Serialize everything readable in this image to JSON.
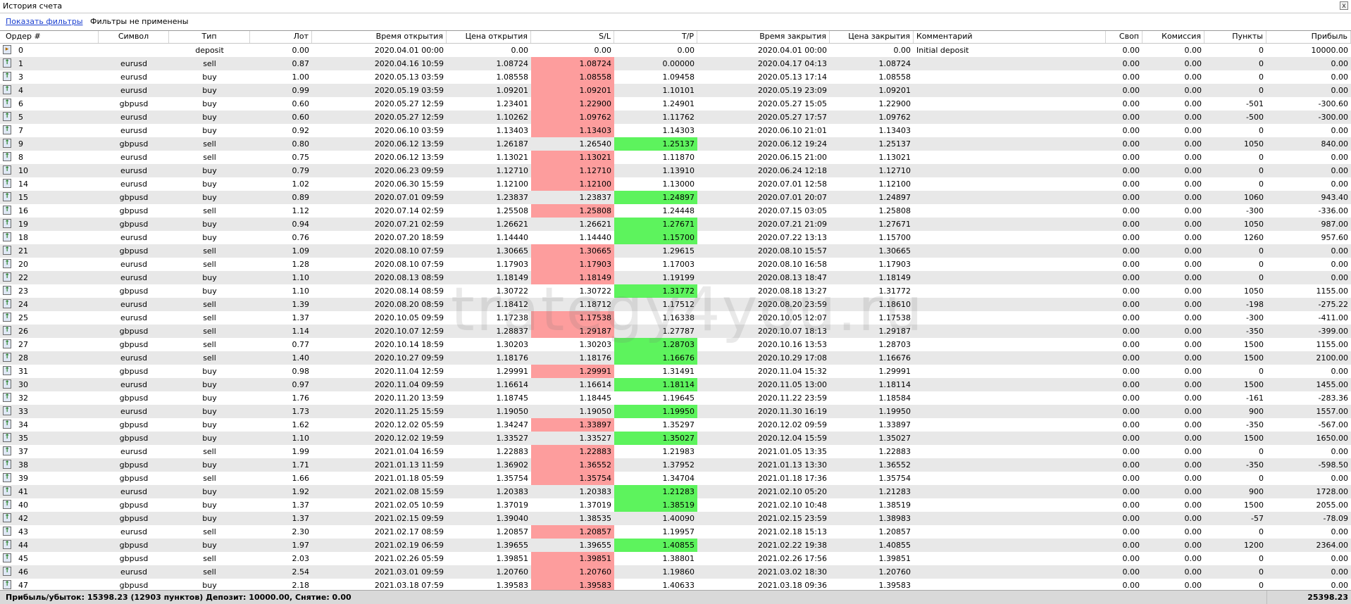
{
  "window": {
    "title": "История счета",
    "close_label": "x"
  },
  "filters": {
    "show_filters": "Показать фильтры",
    "status": "Фильтры не применены"
  },
  "columns": [
    "Ордер #",
    "Символ",
    "Тип",
    "Лот",
    "Время открытия",
    "Цена открытия",
    "S/L",
    "T/P",
    "Время закрытия",
    "Цена закрытия",
    "Комментарий",
    "Своп",
    "Комиссия",
    "Пункты",
    "Прибыль"
  ],
  "colors": {
    "sl_hit": "#fd9d9d",
    "tp_hit": "#5df35d",
    "alt_row": "#e8e8e8"
  },
  "watermark": "trategy4you.ru",
  "rows": [
    {
      "order": "0",
      "symbol": "",
      "type": "deposit",
      "lot": "0.00",
      "open_time": "2020.04.01 00:00",
      "open_price": "0.00",
      "sl": "0.00",
      "tp": "0.00",
      "close_time": "2020.04.01 00:00",
      "close_price": "0.00",
      "comment": "Initial deposit",
      "swap": "0.00",
      "commission": "0.00",
      "points": "0",
      "profit": "10000.00",
      "hl": "",
      "icon": "deposit-icon"
    },
    {
      "order": "1",
      "symbol": "eurusd",
      "type": "sell",
      "lot": "0.87",
      "open_time": "2020.04.16 10:59",
      "open_price": "1.08724",
      "sl": "1.08724",
      "tp": "0.00000",
      "close_time": "2020.04.17 04:13",
      "close_price": "1.08724",
      "comment": "",
      "swap": "0.00",
      "commission": "0.00",
      "points": "0",
      "profit": "0.00",
      "hl": "sl",
      "icon": "order-icon"
    },
    {
      "order": "3",
      "symbol": "eurusd",
      "type": "buy",
      "lot": "1.00",
      "open_time": "2020.05.13 03:59",
      "open_price": "1.08558",
      "sl": "1.08558",
      "tp": "1.09458",
      "close_time": "2020.05.13 17:14",
      "close_price": "1.08558",
      "comment": "",
      "swap": "0.00",
      "commission": "0.00",
      "points": "0",
      "profit": "0.00",
      "hl": "sl",
      "icon": "order-icon"
    },
    {
      "order": "4",
      "symbol": "eurusd",
      "type": "buy",
      "lot": "0.99",
      "open_time": "2020.05.19 03:59",
      "open_price": "1.09201",
      "sl": "1.09201",
      "tp": "1.10101",
      "close_time": "2020.05.19 23:09",
      "close_price": "1.09201",
      "comment": "",
      "swap": "0.00",
      "commission": "0.00",
      "points": "0",
      "profit": "0.00",
      "hl": "sl",
      "icon": "order-icon"
    },
    {
      "order": "6",
      "symbol": "gbpusd",
      "type": "buy",
      "lot": "0.60",
      "open_time": "2020.05.27 12:59",
      "open_price": "1.23401",
      "sl": "1.22900",
      "tp": "1.24901",
      "close_time": "2020.05.27 15:05",
      "close_price": "1.22900",
      "comment": "",
      "swap": "0.00",
      "commission": "0.00",
      "points": "-501",
      "profit": "-300.60",
      "hl": "sl",
      "icon": "order-icon"
    },
    {
      "order": "5",
      "symbol": "eurusd",
      "type": "buy",
      "lot": "0.60",
      "open_time": "2020.05.27 12:59",
      "open_price": "1.10262",
      "sl": "1.09762",
      "tp": "1.11762",
      "close_time": "2020.05.27 17:57",
      "close_price": "1.09762",
      "comment": "",
      "swap": "0.00",
      "commission": "0.00",
      "points": "-500",
      "profit": "-300.00",
      "hl": "sl",
      "icon": "order-icon"
    },
    {
      "order": "7",
      "symbol": "eurusd",
      "type": "buy",
      "lot": "0.92",
      "open_time": "2020.06.10 03:59",
      "open_price": "1.13403",
      "sl": "1.13403",
      "tp": "1.14303",
      "close_time": "2020.06.10 21:01",
      "close_price": "1.13403",
      "comment": "",
      "swap": "0.00",
      "commission": "0.00",
      "points": "0",
      "profit": "0.00",
      "hl": "sl",
      "icon": "order-icon"
    },
    {
      "order": "9",
      "symbol": "gbpusd",
      "type": "sell",
      "lot": "0.80",
      "open_time": "2020.06.12 13:59",
      "open_price": "1.26187",
      "sl": "1.26540",
      "tp": "1.25137",
      "close_time": "2020.06.12 19:24",
      "close_price": "1.25137",
      "comment": "",
      "swap": "0.00",
      "commission": "0.00",
      "points": "1050",
      "profit": "840.00",
      "hl": "tp",
      "icon": "order-icon"
    },
    {
      "order": "8",
      "symbol": "eurusd",
      "type": "sell",
      "lot": "0.75",
      "open_time": "2020.06.12 13:59",
      "open_price": "1.13021",
      "sl": "1.13021",
      "tp": "1.11870",
      "close_time": "2020.06.15 21:00",
      "close_price": "1.13021",
      "comment": "",
      "swap": "0.00",
      "commission": "0.00",
      "points": "0",
      "profit": "0.00",
      "hl": "sl",
      "icon": "order-icon"
    },
    {
      "order": "10",
      "symbol": "eurusd",
      "type": "buy",
      "lot": "0.79",
      "open_time": "2020.06.23 09:59",
      "open_price": "1.12710",
      "sl": "1.12710",
      "tp": "1.13910",
      "close_time": "2020.06.24 12:18",
      "close_price": "1.12710",
      "comment": "",
      "swap": "0.00",
      "commission": "0.00",
      "points": "0",
      "profit": "0.00",
      "hl": "sl",
      "icon": "order-icon"
    },
    {
      "order": "14",
      "symbol": "eurusd",
      "type": "buy",
      "lot": "1.02",
      "open_time": "2020.06.30 15:59",
      "open_price": "1.12100",
      "sl": "1.12100",
      "tp": "1.13000",
      "close_time": "2020.07.01 12:58",
      "close_price": "1.12100",
      "comment": "",
      "swap": "0.00",
      "commission": "0.00",
      "points": "0",
      "profit": "0.00",
      "hl": "sl",
      "icon": "order-icon"
    },
    {
      "order": "15",
      "symbol": "gbpusd",
      "type": "buy",
      "lot": "0.89",
      "open_time": "2020.07.01 09:59",
      "open_price": "1.23837",
      "sl": "1.23837",
      "tp": "1.24897",
      "close_time": "2020.07.01 20:07",
      "close_price": "1.24897",
      "comment": "",
      "swap": "0.00",
      "commission": "0.00",
      "points": "1060",
      "profit": "943.40",
      "hl": "tp",
      "icon": "order-icon"
    },
    {
      "order": "16",
      "symbol": "gbpusd",
      "type": "sell",
      "lot": "1.12",
      "open_time": "2020.07.14 02:59",
      "open_price": "1.25508",
      "sl": "1.25808",
      "tp": "1.24448",
      "close_time": "2020.07.15 03:05",
      "close_price": "1.25808",
      "comment": "",
      "swap": "0.00",
      "commission": "0.00",
      "points": "-300",
      "profit": "-336.00",
      "hl": "sl",
      "icon": "order-icon"
    },
    {
      "order": "19",
      "symbol": "gbpusd",
      "type": "buy",
      "lot": "0.94",
      "open_time": "2020.07.21 02:59",
      "open_price": "1.26621",
      "sl": "1.26621",
      "tp": "1.27671",
      "close_time": "2020.07.21 21:09",
      "close_price": "1.27671",
      "comment": "",
      "swap": "0.00",
      "commission": "0.00",
      "points": "1050",
      "profit": "987.00",
      "hl": "tp",
      "icon": "order-icon"
    },
    {
      "order": "18",
      "symbol": "eurusd",
      "type": "buy",
      "lot": "0.76",
      "open_time": "2020.07.20 18:59",
      "open_price": "1.14440",
      "sl": "1.14440",
      "tp": "1.15700",
      "close_time": "2020.07.22 13:13",
      "close_price": "1.15700",
      "comment": "",
      "swap": "0.00",
      "commission": "0.00",
      "points": "1260",
      "profit": "957.60",
      "hl": "tp",
      "icon": "order-icon"
    },
    {
      "order": "21",
      "symbol": "gbpusd",
      "type": "sell",
      "lot": "1.09",
      "open_time": "2020.08.10 07:59",
      "open_price": "1.30665",
      "sl": "1.30665",
      "tp": "1.29615",
      "close_time": "2020.08.10 15:57",
      "close_price": "1.30665",
      "comment": "",
      "swap": "0.00",
      "commission": "0.00",
      "points": "0",
      "profit": "0.00",
      "hl": "sl",
      "icon": "order-icon"
    },
    {
      "order": "20",
      "symbol": "eurusd",
      "type": "sell",
      "lot": "1.28",
      "open_time": "2020.08.10 07:59",
      "open_price": "1.17903",
      "sl": "1.17903",
      "tp": "1.17003",
      "close_time": "2020.08.10 16:58",
      "close_price": "1.17903",
      "comment": "",
      "swap": "0.00",
      "commission": "0.00",
      "points": "0",
      "profit": "0.00",
      "hl": "sl",
      "icon": "order-icon"
    },
    {
      "order": "22",
      "symbol": "eurusd",
      "type": "buy",
      "lot": "1.10",
      "open_time": "2020.08.13 08:59",
      "open_price": "1.18149",
      "sl": "1.18149",
      "tp": "1.19199",
      "close_time": "2020.08.13 18:47",
      "close_price": "1.18149",
      "comment": "",
      "swap": "0.00",
      "commission": "0.00",
      "points": "0",
      "profit": "0.00",
      "hl": "sl",
      "icon": "order-icon"
    },
    {
      "order": "23",
      "symbol": "gbpusd",
      "type": "buy",
      "lot": "1.10",
      "open_time": "2020.08.14 08:59",
      "open_price": "1.30722",
      "sl": "1.30722",
      "tp": "1.31772",
      "close_time": "2020.08.18 13:27",
      "close_price": "1.31772",
      "comment": "",
      "swap": "0.00",
      "commission": "0.00",
      "points": "1050",
      "profit": "1155.00",
      "hl": "tp",
      "icon": "order-icon"
    },
    {
      "order": "24",
      "symbol": "eurusd",
      "type": "sell",
      "lot": "1.39",
      "open_time": "2020.08.20 08:59",
      "open_price": "1.18412",
      "sl": "1.18712",
      "tp": "1.17512",
      "close_time": "2020.08.20 23:59",
      "close_price": "1.18610",
      "comment": "",
      "swap": "0.00",
      "commission": "0.00",
      "points": "-198",
      "profit": "-275.22",
      "hl": "",
      "icon": "order-icon"
    },
    {
      "order": "25",
      "symbol": "eurusd",
      "type": "sell",
      "lot": "1.37",
      "open_time": "2020.10.05 09:59",
      "open_price": "1.17238",
      "sl": "1.17538",
      "tp": "1.16338",
      "close_time": "2020.10.05 12:07",
      "close_price": "1.17538",
      "comment": "",
      "swap": "0.00",
      "commission": "0.00",
      "points": "-300",
      "profit": "-411.00",
      "hl": "sl",
      "icon": "order-icon"
    },
    {
      "order": "26",
      "symbol": "gbpusd",
      "type": "sell",
      "lot": "1.14",
      "open_time": "2020.10.07 12:59",
      "open_price": "1.28837",
      "sl": "1.29187",
      "tp": "1.27787",
      "close_time": "2020.10.07 18:13",
      "close_price": "1.29187",
      "comment": "",
      "swap": "0.00",
      "commission": "0.00",
      "points": "-350",
      "profit": "-399.00",
      "hl": "sl",
      "icon": "order-icon"
    },
    {
      "order": "27",
      "symbol": "gbpusd",
      "type": "sell",
      "lot": "0.77",
      "open_time": "2020.10.14 18:59",
      "open_price": "1.30203",
      "sl": "1.30203",
      "tp": "1.28703",
      "close_time": "2020.10.16 13:53",
      "close_price": "1.28703",
      "comment": "",
      "swap": "0.00",
      "commission": "0.00",
      "points": "1500",
      "profit": "1155.00",
      "hl": "tp",
      "icon": "order-icon"
    },
    {
      "order": "28",
      "symbol": "eurusd",
      "type": "sell",
      "lot": "1.40",
      "open_time": "2020.10.27 09:59",
      "open_price": "1.18176",
      "sl": "1.18176",
      "tp": "1.16676",
      "close_time": "2020.10.29 17:08",
      "close_price": "1.16676",
      "comment": "",
      "swap": "0.00",
      "commission": "0.00",
      "points": "1500",
      "profit": "2100.00",
      "hl": "tp",
      "icon": "order-icon"
    },
    {
      "order": "31",
      "symbol": "gbpusd",
      "type": "buy",
      "lot": "0.98",
      "open_time": "2020.11.04 12:59",
      "open_price": "1.29991",
      "sl": "1.29991",
      "tp": "1.31491",
      "close_time": "2020.11.04 15:32",
      "close_price": "1.29991",
      "comment": "",
      "swap": "0.00",
      "commission": "0.00",
      "points": "0",
      "profit": "0.00",
      "hl": "sl",
      "icon": "order-icon"
    },
    {
      "order": "30",
      "symbol": "eurusd",
      "type": "buy",
      "lot": "0.97",
      "open_time": "2020.11.04 09:59",
      "open_price": "1.16614",
      "sl": "1.16614",
      "tp": "1.18114",
      "close_time": "2020.11.05 13:00",
      "close_price": "1.18114",
      "comment": "",
      "swap": "0.00",
      "commission": "0.00",
      "points": "1500",
      "profit": "1455.00",
      "hl": "tp",
      "icon": "order-icon"
    },
    {
      "order": "32",
      "symbol": "gbpusd",
      "type": "buy",
      "lot": "1.76",
      "open_time": "2020.11.20 13:59",
      "open_price": "1.18745",
      "sl": "1.18445",
      "tp": "1.19645",
      "close_time": "2020.11.22 23:59",
      "close_price": "1.18584",
      "comment": "",
      "swap": "0.00",
      "commission": "0.00",
      "points": "-161",
      "profit": "-283.36",
      "hl": "",
      "icon": "order-icon"
    },
    {
      "order": "33",
      "symbol": "eurusd",
      "type": "buy",
      "lot": "1.73",
      "open_time": "2020.11.25 15:59",
      "open_price": "1.19050",
      "sl": "1.19050",
      "tp": "1.19950",
      "close_time": "2020.11.30 16:19",
      "close_price": "1.19950",
      "comment": "",
      "swap": "0.00",
      "commission": "0.00",
      "points": "900",
      "profit": "1557.00",
      "hl": "tp",
      "icon": "order-icon"
    },
    {
      "order": "34",
      "symbol": "gbpusd",
      "type": "buy",
      "lot": "1.62",
      "open_time": "2020.12.02 05:59",
      "open_price": "1.34247",
      "sl": "1.33897",
      "tp": "1.35297",
      "close_time": "2020.12.02 09:59",
      "close_price": "1.33897",
      "comment": "",
      "swap": "0.00",
      "commission": "0.00",
      "points": "-350",
      "profit": "-567.00",
      "hl": "sl",
      "icon": "order-icon"
    },
    {
      "order": "35",
      "symbol": "gbpusd",
      "type": "buy",
      "lot": "1.10",
      "open_time": "2020.12.02 19:59",
      "open_price": "1.33527",
      "sl": "1.33527",
      "tp": "1.35027",
      "close_time": "2020.12.04 15:59",
      "close_price": "1.35027",
      "comment": "",
      "swap": "0.00",
      "commission": "0.00",
      "points": "1500",
      "profit": "1650.00",
      "hl": "tp",
      "icon": "order-icon"
    },
    {
      "order": "37",
      "symbol": "eurusd",
      "type": "sell",
      "lot": "1.99",
      "open_time": "2021.01.04 16:59",
      "open_price": "1.22883",
      "sl": "1.22883",
      "tp": "1.21983",
      "close_time": "2021.01.05 13:35",
      "close_price": "1.22883",
      "comment": "",
      "swap": "0.00",
      "commission": "0.00",
      "points": "0",
      "profit": "0.00",
      "hl": "sl",
      "icon": "order-icon"
    },
    {
      "order": "38",
      "symbol": "gbpusd",
      "type": "buy",
      "lot": "1.71",
      "open_time": "2021.01.13 11:59",
      "open_price": "1.36902",
      "sl": "1.36552",
      "tp": "1.37952",
      "close_time": "2021.01.13 13:30",
      "close_price": "1.36552",
      "comment": "",
      "swap": "0.00",
      "commission": "0.00",
      "points": "-350",
      "profit": "-598.50",
      "hl": "sl",
      "icon": "order-icon"
    },
    {
      "order": "39",
      "symbol": "gbpusd",
      "type": "sell",
      "lot": "1.66",
      "open_time": "2021.01.18 05:59",
      "open_price": "1.35754",
      "sl": "1.35754",
      "tp": "1.34704",
      "close_time": "2021.01.18 17:36",
      "close_price": "1.35754",
      "comment": "",
      "swap": "0.00",
      "commission": "0.00",
      "points": "0",
      "profit": "0.00",
      "hl": "sl",
      "icon": "order-icon"
    },
    {
      "order": "41",
      "symbol": "eurusd",
      "type": "buy",
      "lot": "1.92",
      "open_time": "2021.02.08 15:59",
      "open_price": "1.20383",
      "sl": "1.20383",
      "tp": "1.21283",
      "close_time": "2021.02.10 05:20",
      "close_price": "1.21283",
      "comment": "",
      "swap": "0.00",
      "commission": "0.00",
      "points": "900",
      "profit": "1728.00",
      "hl": "tp",
      "icon": "order-icon"
    },
    {
      "order": "40",
      "symbol": "gbpusd",
      "type": "buy",
      "lot": "1.37",
      "open_time": "2021.02.05 10:59",
      "open_price": "1.37019",
      "sl": "1.37019",
      "tp": "1.38519",
      "close_time": "2021.02.10 10:48",
      "close_price": "1.38519",
      "comment": "",
      "swap": "0.00",
      "commission": "0.00",
      "points": "1500",
      "profit": "2055.00",
      "hl": "tp",
      "icon": "order-icon"
    },
    {
      "order": "42",
      "symbol": "gbpusd",
      "type": "buy",
      "lot": "1.37",
      "open_time": "2021.02.15 09:59",
      "open_price": "1.39040",
      "sl": "1.38535",
      "tp": "1.40090",
      "close_time": "2021.02.15 23:59",
      "close_price": "1.38983",
      "comment": "",
      "swap": "0.00",
      "commission": "0.00",
      "points": "-57",
      "profit": "-78.09",
      "hl": "",
      "icon": "order-icon"
    },
    {
      "order": "43",
      "symbol": "eurusd",
      "type": "sell",
      "lot": "2.30",
      "open_time": "2021.02.17 08:59",
      "open_price": "1.20857",
      "sl": "1.20857",
      "tp": "1.19957",
      "close_time": "2021.02.18 15:13",
      "close_price": "1.20857",
      "comment": "",
      "swap": "0.00",
      "commission": "0.00",
      "points": "0",
      "profit": "0.00",
      "hl": "sl",
      "icon": "order-icon"
    },
    {
      "order": "44",
      "symbol": "gbpusd",
      "type": "buy",
      "lot": "1.97",
      "open_time": "2021.02.19 06:59",
      "open_price": "1.39655",
      "sl": "1.39655",
      "tp": "1.40855",
      "close_time": "2021.02.22 19:38",
      "close_price": "1.40855",
      "comment": "",
      "swap": "0.00",
      "commission": "0.00",
      "points": "1200",
      "profit": "2364.00",
      "hl": "tp",
      "icon": "order-icon"
    },
    {
      "order": "45",
      "symbol": "gbpusd",
      "type": "sell",
      "lot": "2.03",
      "open_time": "2021.02.26 05:59",
      "open_price": "1.39851",
      "sl": "1.39851",
      "tp": "1.38801",
      "close_time": "2021.02.26 17:56",
      "close_price": "1.39851",
      "comment": "",
      "swap": "0.00",
      "commission": "0.00",
      "points": "0",
      "profit": "0.00",
      "hl": "sl",
      "icon": "order-icon"
    },
    {
      "order": "46",
      "symbol": "eurusd",
      "type": "sell",
      "lot": "2.54",
      "open_time": "2021.03.01 09:59",
      "open_price": "1.20760",
      "sl": "1.20760",
      "tp": "1.19860",
      "close_time": "2021.03.02 18:30",
      "close_price": "1.20760",
      "comment": "",
      "swap": "0.00",
      "commission": "0.00",
      "points": "0",
      "profit": "0.00",
      "hl": "sl",
      "icon": "order-icon"
    },
    {
      "order": "47",
      "symbol": "gbpusd",
      "type": "buy",
      "lot": "2.18",
      "open_time": "2021.03.18 07:59",
      "open_price": "1.39583",
      "sl": "1.39583",
      "tp": "1.40633",
      "close_time": "2021.03.18 09:36",
      "close_price": "1.39583",
      "comment": "",
      "swap": "0.00",
      "commission": "0.00",
      "points": "0",
      "profit": "0.00",
      "hl": "sl",
      "icon": "order-icon"
    }
  ],
  "totals": {
    "summary": "Прибыль/убыток: 15398.23 (12903 пунктов) Депозит: 10000.00, Снятие: 0.00",
    "total_profit": "25398.23"
  }
}
